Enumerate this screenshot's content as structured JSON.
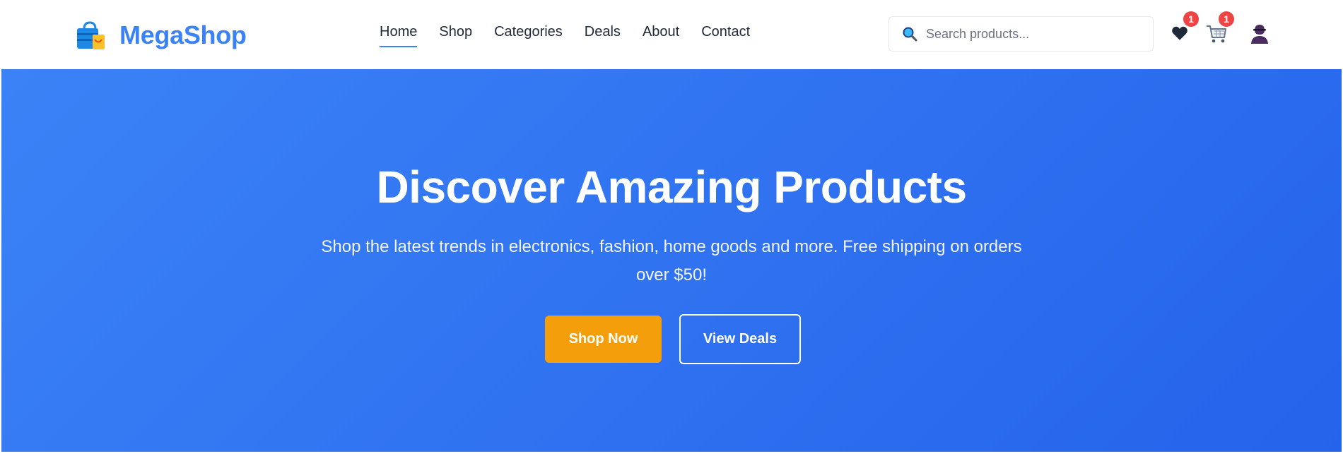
{
  "header": {
    "brand": "MegaShop",
    "nav": [
      {
        "label": "Home",
        "active": true
      },
      {
        "label": "Shop"
      },
      {
        "label": "Categories"
      },
      {
        "label": "Deals"
      },
      {
        "label": "About"
      },
      {
        "label": "Contact"
      }
    ],
    "search": {
      "placeholder": "Search products...",
      "value": ""
    },
    "wishlist": {
      "icon": "heart-icon",
      "count": "1"
    },
    "cart": {
      "icon": "cart-icon",
      "count": "1"
    },
    "account": {
      "icon": "user-icon"
    }
  },
  "hero": {
    "title": "Discover Amazing Products",
    "subtitle": "Shop the latest trends in electronics, fashion, home goods and more. Free shipping on orders over $50!",
    "primary_button": "Shop Now",
    "secondary_button": "View Deals"
  },
  "colors": {
    "brand": "#3b82f6",
    "hero_start": "#3b82f6",
    "hero_end": "#2563eb",
    "accent": "#f59e0b",
    "badge": "#ef4444"
  }
}
